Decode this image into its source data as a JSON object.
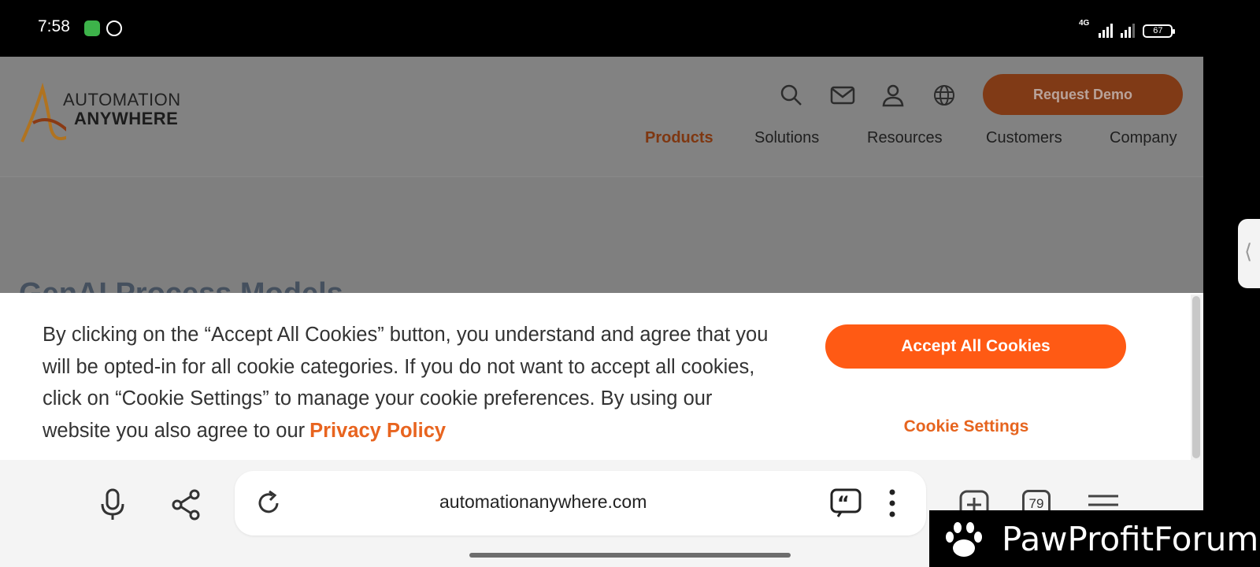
{
  "status_bar": {
    "time": "7:58",
    "network": "4G",
    "battery": "67"
  },
  "header": {
    "logo_line1": "AUTOMATION",
    "logo_line2": "ANYWHERE",
    "request_demo": "Request Demo",
    "nav": [
      "Products",
      "Solutions",
      "Resources",
      "Customers",
      "Company"
    ]
  },
  "hero": {
    "title": "GenAI Process Models"
  },
  "cookie_banner": {
    "message": "By clicking on the “Accept All Cookies” button, you understand and agree that you will be opted-in for all cookie categories. If you do not want to accept all cookies, click on “Cookie Settings” to manage your cookie preferences. By using our website you also agree to our",
    "privacy_link": "Privacy Policy",
    "accept_label": "Accept All Cookies",
    "settings_label": "Cookie Settings"
  },
  "browser": {
    "url": "automationanywhere.com",
    "tab_count": "79",
    "icons": [
      "microphone-icon",
      "share-icon",
      "reload-icon",
      "quote-icon",
      "more-icon",
      "new-tab-icon",
      "tabs-icon",
      "menu-icon"
    ]
  },
  "watermark": {
    "text": "PawProfitForum"
  },
  "colors": {
    "accent": "#ff5a14",
    "link": "#e8641f",
    "demo_dimmed": "#803a16"
  }
}
